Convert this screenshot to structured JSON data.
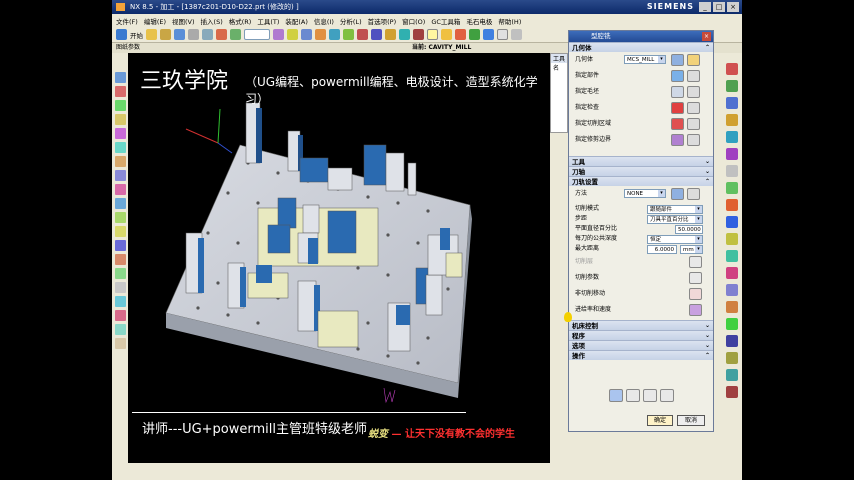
{
  "window": {
    "title": "NX 8.5 - 加工 - [1387c201-D10-D22.prt  (修改的) ]",
    "brand": "SIEMENS",
    "min": "_",
    "max": "□",
    "close": "×"
  },
  "menu": [
    "文件(F)",
    "编辑(E)",
    "视图(V)",
    "插入(S)",
    "格式(R)",
    "工具(T)",
    "装配(A)",
    "信息(I)",
    "分析(L)",
    "首选项(P)",
    "窗口(O)",
    "GC工具箱",
    "毛石电极",
    "帮助(H)"
  ],
  "toolbar": {
    "start_label": "开始",
    "sample_combo": ""
  },
  "subbar": {
    "left": "图纸参数",
    "current": "当前: CAVITY_MILL"
  },
  "overlay": {
    "brand": "三玖学院",
    "subtitle": "（UG编程、powermill编程、电极设计、造型系统化学习）",
    "teacher_line": "讲师---UG+powermill主管班特级老师",
    "signature": "蜕变",
    "slogan": "— 让天下没有教不会的学生"
  },
  "navpanel": {
    "header": "工具",
    "sub": "名"
  },
  "dialog": {
    "title": "型腔铣",
    "sections": {
      "geometry": "几何体",
      "tool": "工具",
      "axis": "刀轴",
      "path_settings": "刀轨设置",
      "machine_control": "机床控制",
      "program": "程序",
      "options": "选项",
      "actions": "操作"
    },
    "geometry": {
      "label": "几何体",
      "value": "MCS_MILL",
      "specify_part": "指定部件",
      "specify_blank": "指定毛坯",
      "specify_check": "指定检查",
      "specify_cut_area": "指定切削区域",
      "specify_trim": "指定修剪边界"
    },
    "path": {
      "method_label": "方法",
      "method_value": "NONE",
      "cut_mode_label": "切削模式",
      "cut_mode_value": "跟随部件",
      "stepover_label": "步距",
      "stepover_value": "刀具平直百分比",
      "percent_label": "平面直径百分比",
      "percent_value": "50.0000",
      "depth_label": "每刀的公共深度",
      "depth_value": "恒定",
      "max_dist_label": "最大距离",
      "max_dist_value": "6.0000",
      "unit": "mm",
      "cut_levels": "切削层",
      "cut_params": "切削参数",
      "non_cut_moves": "非切削移动",
      "feeds_speeds": "进给率和速度"
    },
    "ok_label": "确定",
    "cancel_label": "取消"
  }
}
